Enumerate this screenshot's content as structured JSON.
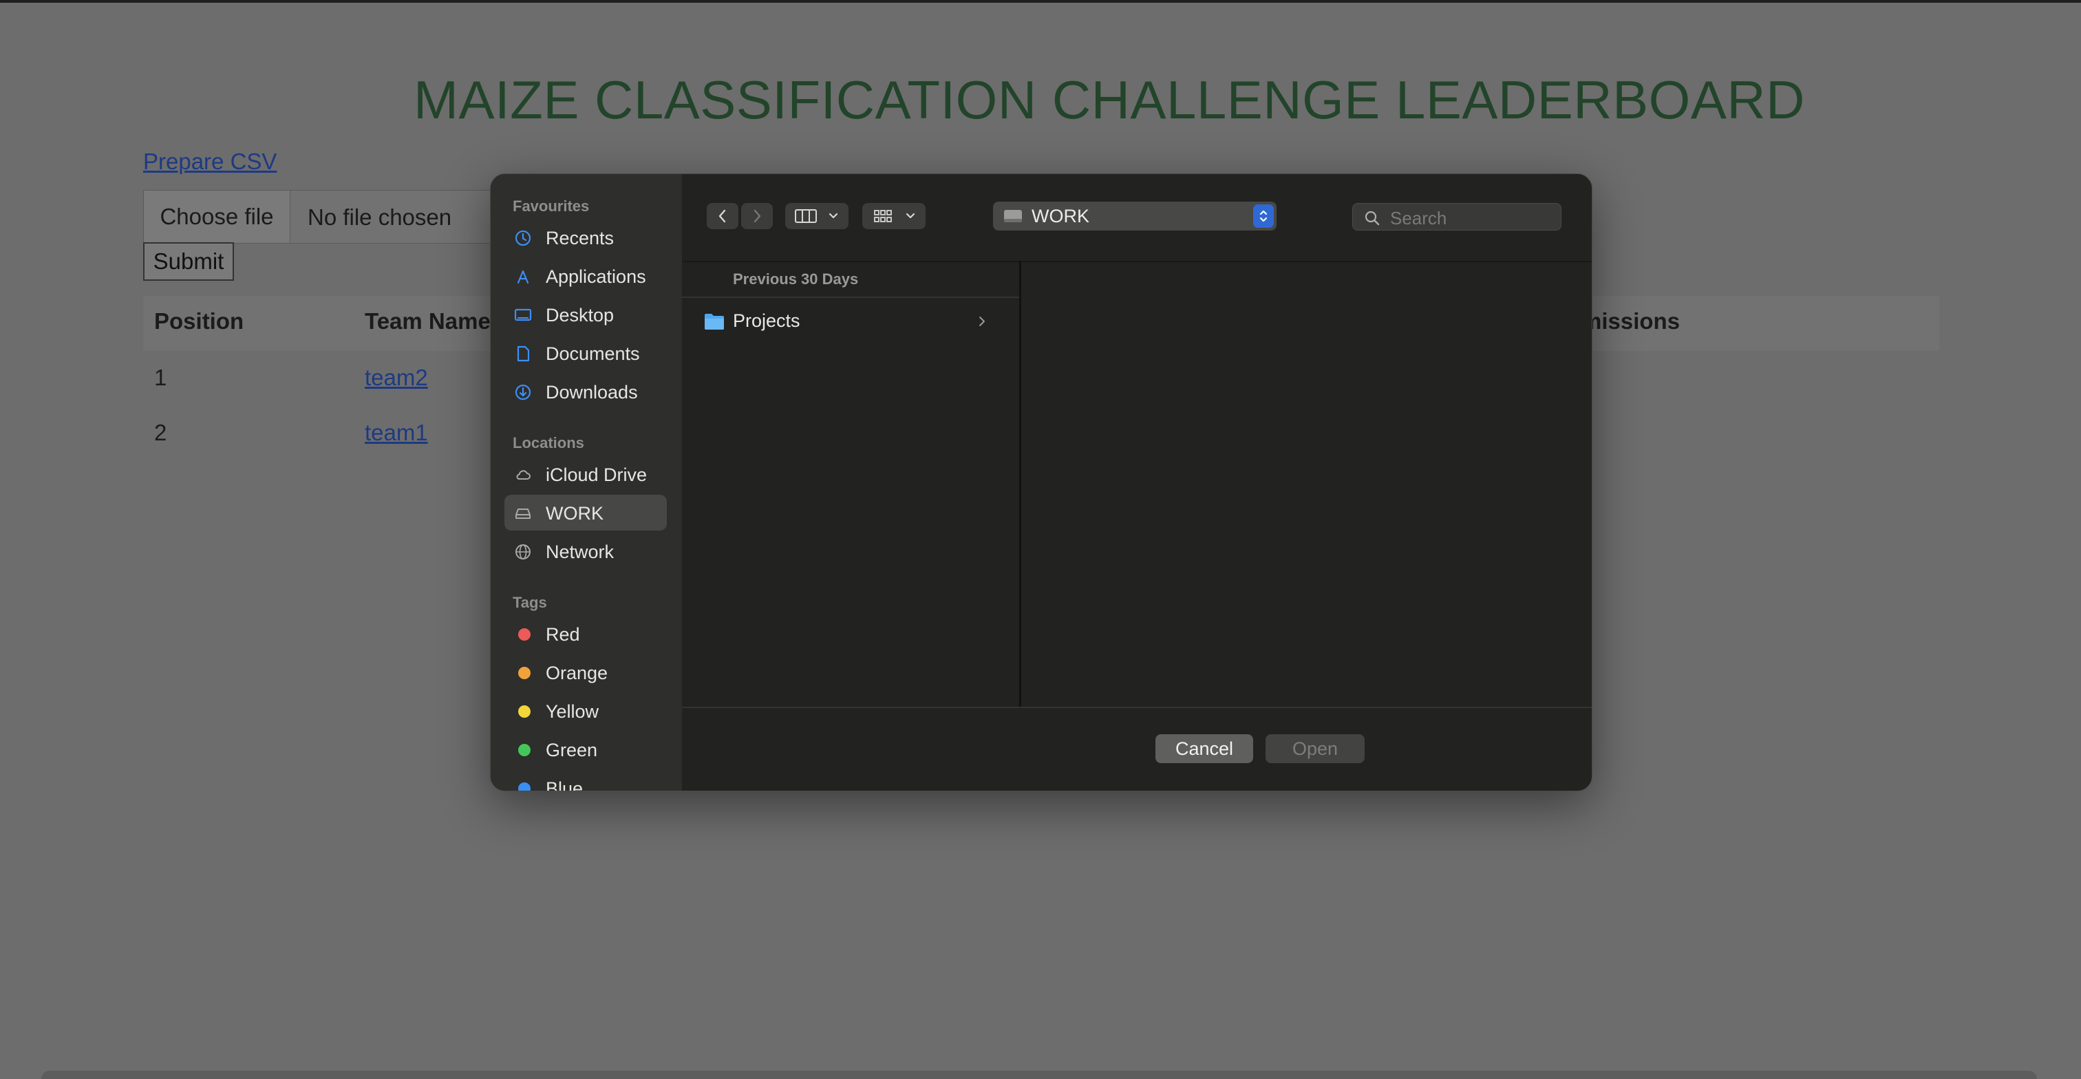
{
  "page": {
    "title": "MAIZE CLASSIFICATION CHALLENGE LEADERBOARD",
    "prepare_link": "Prepare CSV",
    "choose_file": "Choose file",
    "file_status": "No file chosen",
    "submit": "Submit",
    "table": {
      "headers": [
        "Position",
        "Team Name",
        "missions"
      ],
      "rows": [
        {
          "position": "1",
          "team": "team2"
        },
        {
          "position": "2",
          "team": "team1"
        }
      ]
    }
  },
  "dialog": {
    "sidebar": {
      "favourites_title": "Favourites",
      "favourites": [
        {
          "label": "Recents",
          "icon": "clock-icon"
        },
        {
          "label": "Applications",
          "icon": "applications-icon"
        },
        {
          "label": "Desktop",
          "icon": "desktop-icon"
        },
        {
          "label": "Documents",
          "icon": "document-icon"
        },
        {
          "label": "Downloads",
          "icon": "download-icon"
        }
      ],
      "locations_title": "Locations",
      "locations": [
        {
          "label": "iCloud Drive",
          "icon": "cloud-icon"
        },
        {
          "label": "WORK",
          "icon": "drive-icon",
          "selected": true
        },
        {
          "label": "Network",
          "icon": "network-icon"
        }
      ],
      "tags_title": "Tags",
      "tags": [
        {
          "label": "Red",
          "color": "#ec5a5a"
        },
        {
          "label": "Orange",
          "color": "#f2a23a"
        },
        {
          "label": "Yellow",
          "color": "#f2d63a"
        },
        {
          "label": "Green",
          "color": "#45c65a"
        },
        {
          "label": "Blue",
          "color": "#3a8ff2"
        }
      ]
    },
    "toolbar": {
      "location": "WORK",
      "search_placeholder": "Search"
    },
    "browser": {
      "group_header": "Previous 30 Days",
      "items": [
        {
          "name": "Projects",
          "icon": "folder-icon"
        }
      ]
    },
    "buttons": {
      "cancel": "Cancel",
      "open": "Open"
    }
  }
}
